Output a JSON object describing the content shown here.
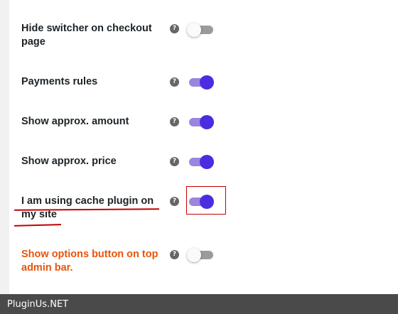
{
  "settings": [
    {
      "label_line1": "Hide switcher on checkout",
      "label_line2": "page",
      "help": "?",
      "enabled": false
    },
    {
      "label_line1": "Payments rules",
      "label_line2": "",
      "help": "?",
      "enabled": true
    },
    {
      "label_line1": "Show approx. amount",
      "label_line2": "",
      "help": "?",
      "enabled": true
    },
    {
      "label_line1": "Show approx. price",
      "label_line2": "",
      "help": "?",
      "enabled": true
    },
    {
      "label_line1": "I am using cache plugin on",
      "label_line2": "my site",
      "help": "?",
      "enabled": true
    },
    {
      "label_line1": "Show options button on top",
      "label_line2": "admin bar.",
      "help": "?",
      "enabled": false
    }
  ],
  "footer": {
    "watermark": "PluginUs.NET"
  },
  "colors": {
    "toggle_on_knob": "#4b2ce0",
    "toggle_on_track": "#9b85df",
    "toggle_off_track": "#9b9b9b",
    "annotation_red": "#c00000",
    "orange_label": "#e8540b"
  }
}
